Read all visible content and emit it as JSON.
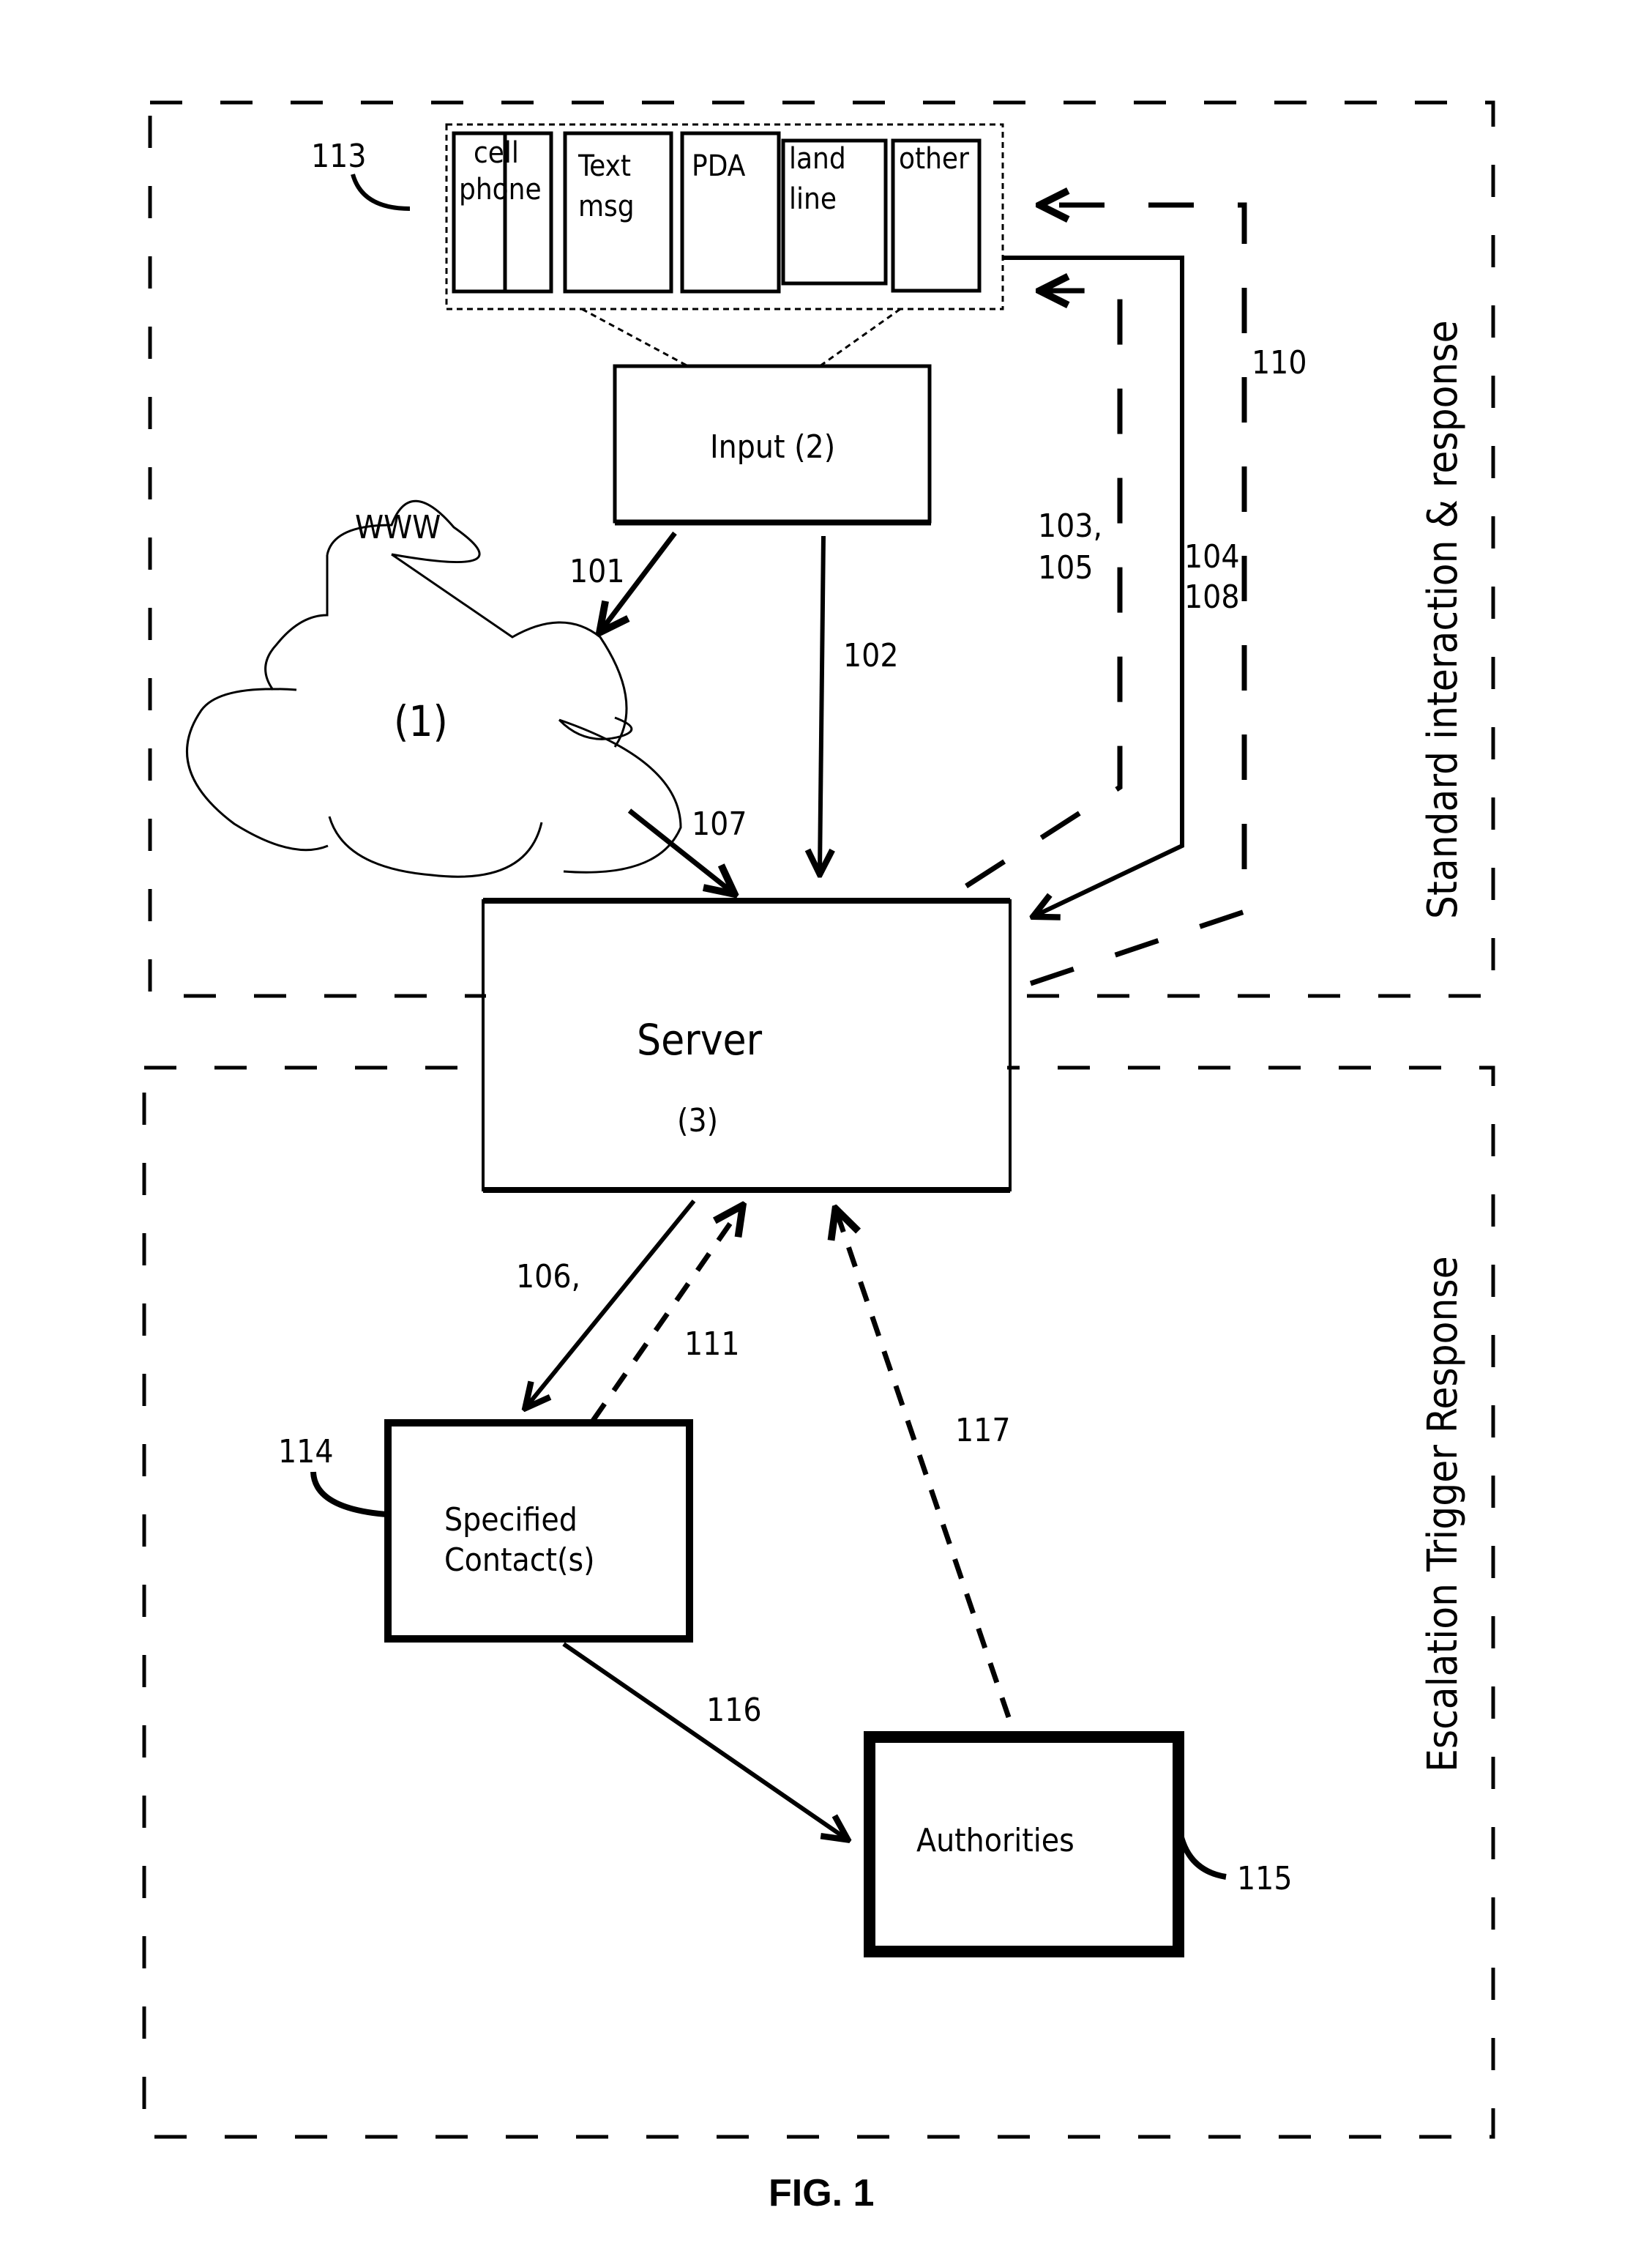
{
  "figure": {
    "caption": "FIG. 1",
    "regions": {
      "top": "Standard interaction & response",
      "bottom": "Escalation Trigger Response"
    },
    "devices": {
      "ref": "113",
      "items": [
        {
          "line1": "cell",
          "line2": "phone"
        },
        {
          "line1": "Text",
          "line2": "msg"
        },
        {
          "line1": "PDA",
          "line2": ""
        },
        {
          "line1": "land",
          "line2": "line"
        },
        {
          "line1": "other",
          "line2": ""
        }
      ]
    },
    "input": {
      "label": "Input (2)"
    },
    "cloud": {
      "top_label": "WWW",
      "label": "(1)"
    },
    "server": {
      "title": "Server",
      "number": "(3)"
    },
    "contact": {
      "line1": "Specified",
      "line2": "Contact(s)",
      "ref": "114"
    },
    "authorities": {
      "label": "Authorities",
      "ref": "115"
    },
    "arrows": {
      "a101": "101",
      "a102": "102",
      "a103_105_l1": "103,",
      "a103_105_l2": "105",
      "a104_108_l1": "104,",
      "a104_108_l2": "108",
      "a107": "107",
      "a110": "110",
      "a106": "106,",
      "a111": "111",
      "a116": "116",
      "a117": "117"
    }
  }
}
